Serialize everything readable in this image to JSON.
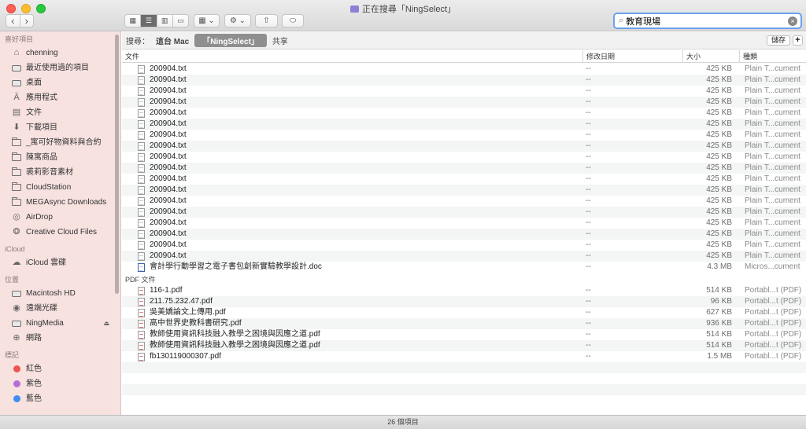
{
  "window": {
    "title": "正在搜尋「NingSelect」"
  },
  "toolbar": {
    "back_icon": "chevron-left-icon",
    "forward_icon": "chevron-right-icon",
    "view_modes": [
      "icon-view-icon",
      "list-view-icon",
      "column-view-icon",
      "gallery-view-icon"
    ],
    "active_view": "list-view-icon",
    "group_button_icon": "group-by-icon",
    "action_button_icon": "gear-icon",
    "share_icon": "share-icon",
    "tag_icon": "tag-icon",
    "search_value": "教育現場"
  },
  "sidebar": {
    "favorites_header": "喜好項目",
    "favorites": [
      {
        "label": "chenning",
        "icon": "home-icon"
      },
      {
        "label": "最近使用過的項目",
        "icon": "recents-icon"
      },
      {
        "label": "桌面",
        "icon": "desktop-icon"
      },
      {
        "label": "應用程式",
        "icon": "applications-icon"
      },
      {
        "label": "文件",
        "icon": "documents-icon"
      },
      {
        "label": "下載項目",
        "icon": "downloads-icon"
      },
      {
        "label": "_寓可好物資料與合約",
        "icon": "folder-icon"
      },
      {
        "label": "陳寓商品",
        "icon": "folder-icon"
      },
      {
        "label": "裘莉影音素材",
        "icon": "folder-icon"
      },
      {
        "label": "CloudStation",
        "icon": "folder-icon"
      },
      {
        "label": "MEGAsync Downloads",
        "icon": "folder-icon"
      },
      {
        "label": "AirDrop",
        "icon": "airdrop-icon"
      },
      {
        "label": "Creative Cloud Files",
        "icon": "creative-cloud-icon"
      }
    ],
    "icloud_header": "iCloud",
    "icloud": [
      {
        "label": "iCloud 雲碟",
        "icon": "cloud-icon"
      }
    ],
    "locations_header": "位置",
    "locations": [
      {
        "label": "Macintosh HD",
        "icon": "disk-icon"
      },
      {
        "label": "遠端光碟",
        "icon": "optical-disk-icon"
      },
      {
        "label": "NingMedia",
        "icon": "disk-icon",
        "eject": true
      },
      {
        "label": "網路",
        "icon": "network-icon"
      }
    ],
    "tags_header": "標記",
    "tags": [
      {
        "label": "紅色",
        "color": "#ec5353"
      },
      {
        "label": "紫色",
        "color": "#b36fd8"
      },
      {
        "label": "藍色",
        "color": "#3f8ff0"
      }
    ]
  },
  "scope": {
    "label": "搜尋：",
    "options": [
      "這台 Mac",
      "「NingSelect」",
      "共享"
    ],
    "selected": 1,
    "save_label": "儲存",
    "add_label": "+"
  },
  "columns": {
    "name": "文件",
    "date": "修改日期",
    "size": "大小",
    "kind": "種類"
  },
  "groups": [
    {
      "header": "",
      "type": "txt",
      "files": [
        {
          "name": "200904.txt",
          "date": "--",
          "size": "425 KB",
          "kind": "Plain T...cument"
        },
        {
          "name": "200904.txt",
          "date": "--",
          "size": "425 KB",
          "kind": "Plain T...cument"
        },
        {
          "name": "200904.txt",
          "date": "--",
          "size": "425 KB",
          "kind": "Plain T...cument"
        },
        {
          "name": "200904.txt",
          "date": "--",
          "size": "425 KB",
          "kind": "Plain T...cument"
        },
        {
          "name": "200904.txt",
          "date": "--",
          "size": "425 KB",
          "kind": "Plain T...cument"
        },
        {
          "name": "200904.txt",
          "date": "--",
          "size": "425 KB",
          "kind": "Plain T...cument"
        },
        {
          "name": "200904.txt",
          "date": "--",
          "size": "425 KB",
          "kind": "Plain T...cument"
        },
        {
          "name": "200904.txt",
          "date": "--",
          "size": "425 KB",
          "kind": "Plain T...cument"
        },
        {
          "name": "200904.txt",
          "date": "--",
          "size": "425 KB",
          "kind": "Plain T...cument"
        },
        {
          "name": "200904.txt",
          "date": "--",
          "size": "425 KB",
          "kind": "Plain T...cument"
        },
        {
          "name": "200904.txt",
          "date": "--",
          "size": "425 KB",
          "kind": "Plain T...cument"
        },
        {
          "name": "200904.txt",
          "date": "--",
          "size": "425 KB",
          "kind": "Plain T...cument"
        },
        {
          "name": "200904.txt",
          "date": "--",
          "size": "425 KB",
          "kind": "Plain T...cument"
        },
        {
          "name": "200904.txt",
          "date": "--",
          "size": "425 KB",
          "kind": "Plain T...cument"
        },
        {
          "name": "200904.txt",
          "date": "--",
          "size": "425 KB",
          "kind": "Plain T...cument"
        },
        {
          "name": "200904.txt",
          "date": "--",
          "size": "425 KB",
          "kind": "Plain T...cument"
        },
        {
          "name": "200904.txt",
          "date": "--",
          "size": "425 KB",
          "kind": "Plain T...cument"
        },
        {
          "name": "200904.txt",
          "date": "--",
          "size": "425 KB",
          "kind": "Plain T...cument"
        },
        {
          "name": "會計學行動學習之電子書包創新實驗教學設計.doc",
          "date": "--",
          "size": "4.3 MB",
          "kind": "Micros...cument",
          "doc": true
        }
      ]
    },
    {
      "header": "PDF 文件",
      "type": "pdf",
      "files": [
        {
          "name": "116-1.pdf",
          "date": "--",
          "size": "514 KB",
          "kind": "Portabl...t (PDF)"
        },
        {
          "name": "211.75.232.47.pdf",
          "date": "--",
          "size": "96 KB",
          "kind": "Portabl...t (PDF)"
        },
        {
          "name": "吳美嬌論文上傳用.pdf",
          "date": "--",
          "size": "627 KB",
          "kind": "Portabl...t (PDF)"
        },
        {
          "name": "高中世界史教科書研究.pdf",
          "date": "--",
          "size": "936 KB",
          "kind": "Portabl...t (PDF)"
        },
        {
          "name": "教師使用資訊科技融入教學之困境與因應之道.pdf",
          "date": "--",
          "size": "514 KB",
          "kind": "Portabl...t (PDF)"
        },
        {
          "name": "教師使用資訊科技融入教學之困境與因應之道.pdf",
          "date": "--",
          "size": "514 KB",
          "kind": "Portabl...t (PDF)"
        },
        {
          "name": "fb130119000307.pdf",
          "date": "--",
          "size": "1.5 MB",
          "kind": "Portabl...t (PDF)"
        }
      ]
    }
  ],
  "status": {
    "text": "26 個項目"
  }
}
